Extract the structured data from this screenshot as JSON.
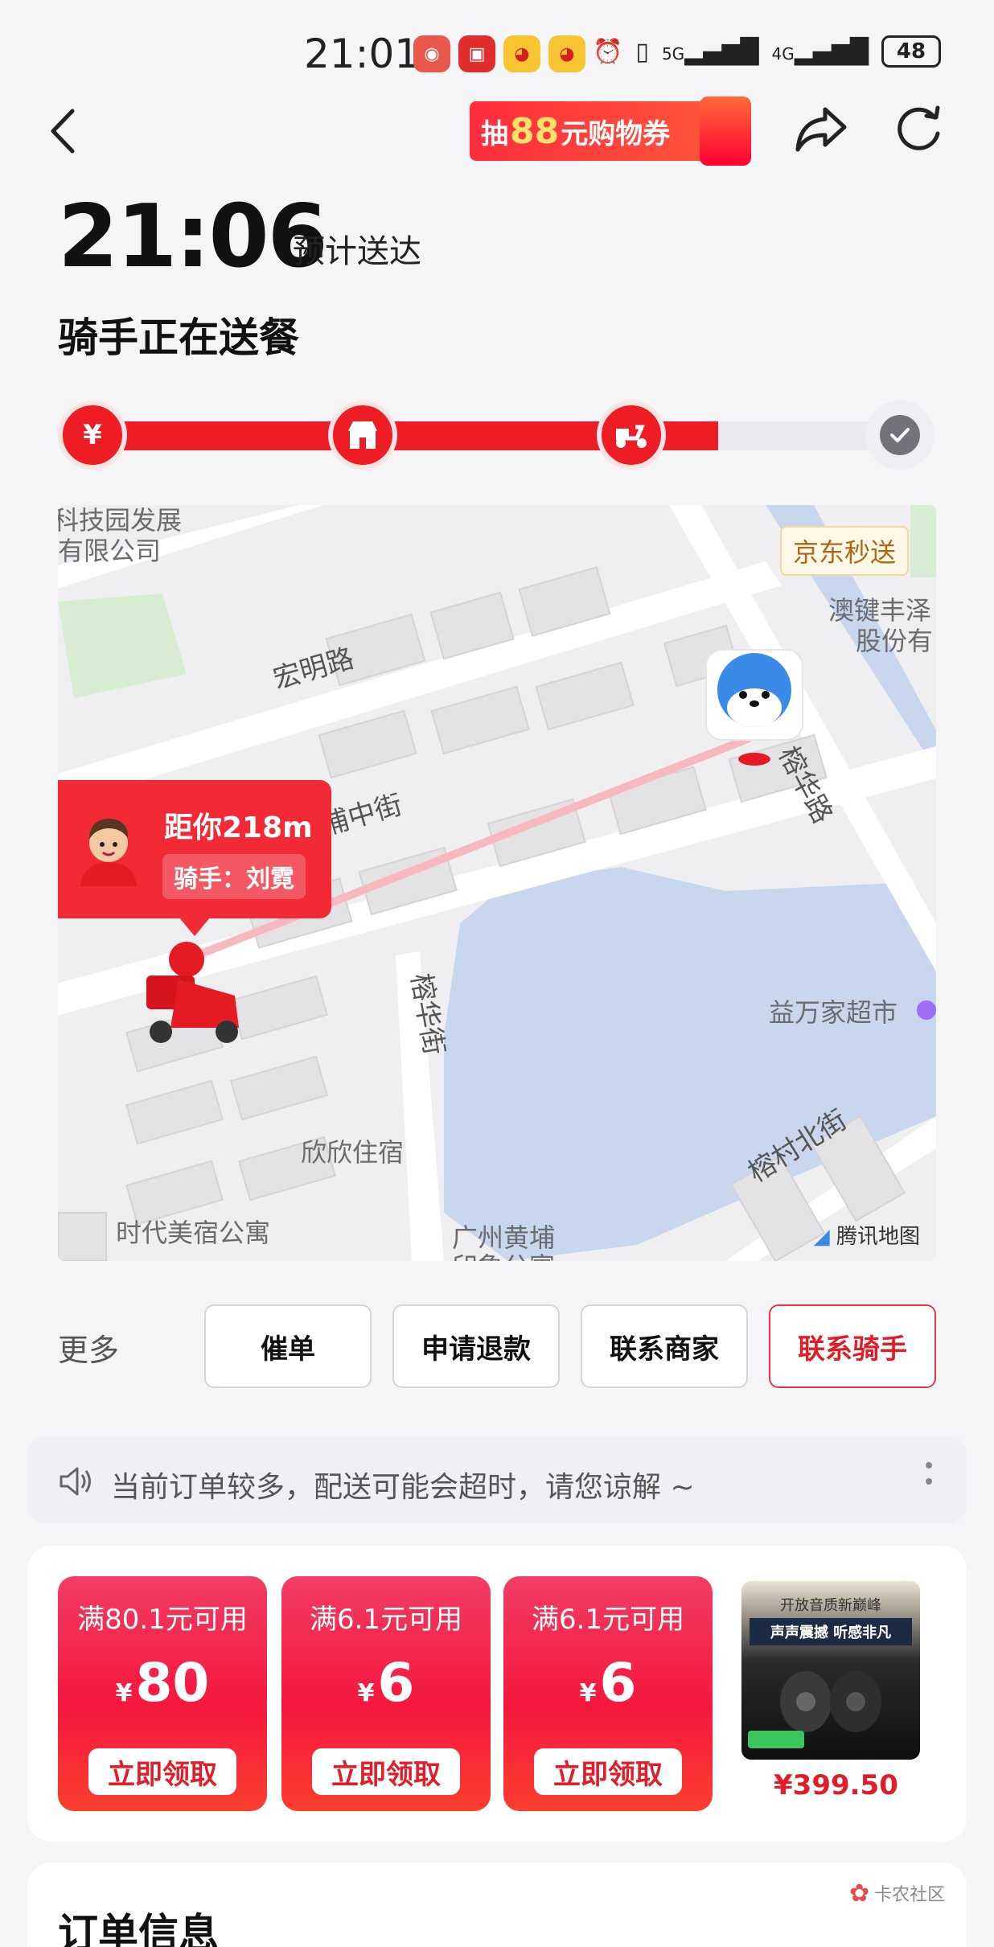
{
  "status_bar": {
    "time": "21:01",
    "battery": "48",
    "net_5g": "5G",
    "net_4g": "4G"
  },
  "nav": {
    "promo_prefix": "抽",
    "promo_amount": "88",
    "promo_suffix": "元购物券"
  },
  "header": {
    "eta_time": "21:06",
    "eta_label": "预计送达",
    "status": "骑手正在送餐"
  },
  "progress": {
    "steps": [
      "¥",
      "store",
      "scooter",
      "done"
    ],
    "completed_fraction": 0.77
  },
  "map": {
    "tag": "京东秒送",
    "rider_distance": "距你218m",
    "rider_name": "骑手：刘霓",
    "labels": {
      "park": "科技园发展",
      "park2": "有限公司",
      "hongming": "宏明路",
      "puzhong": "浦中街",
      "rongtian": "榕华路",
      "aojian": "澳键丰泽",
      "aojian2": "股份有",
      "rongjie": "榕华街",
      "yiwanjia": "益万家超市",
      "rongcun": "榕村北街",
      "xinxin": "欣欣住宿",
      "shidai": "时代美宿公寓",
      "guangzhou": "广州黄埔",
      "yinxiang": "印象公寓"
    },
    "provider": "腾讯地图"
  },
  "actions": {
    "more_label": "更多",
    "buttons": [
      "催单",
      "申请退款",
      "联系商家",
      "联系骑手"
    ]
  },
  "notice": {
    "text": "当前订单较多，配送可能会超时，请您谅解 ~"
  },
  "coupons": [
    {
      "condition": "满80.1元可用",
      "amount": "80",
      "claim": "立即领取"
    },
    {
      "condition": "满6.1元可用",
      "amount": "6",
      "claim": "立即领取"
    },
    {
      "condition": "满6.1元可用",
      "amount": "6",
      "claim": "立即领取"
    }
  ],
  "currency_symbol": "¥",
  "product": {
    "price": "¥399.50",
    "ad_line1": "开放音质新巅峰",
    "ad_line2": "声声震撼  听感非凡"
  },
  "order": {
    "title": "订单信息"
  },
  "watermark": "卡农社区"
}
